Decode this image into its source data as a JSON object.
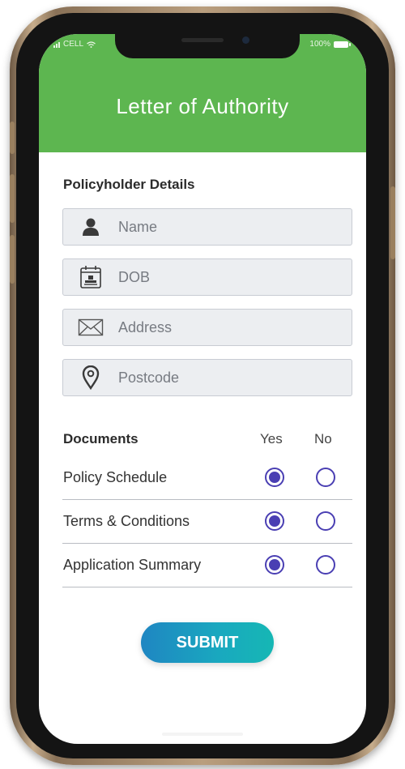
{
  "status_bar": {
    "carrier": "CELL",
    "battery": "100%"
  },
  "header": {
    "title": "Letter of Authority",
    "color": "#5db650"
  },
  "policyholder": {
    "section_label": "Policyholder Details",
    "fields": [
      {
        "icon": "person-icon",
        "placeholder": "Name",
        "value": ""
      },
      {
        "icon": "calendar-icon",
        "placeholder": "DOB",
        "value": ""
      },
      {
        "icon": "envelope-icon",
        "placeholder": "Address",
        "value": ""
      },
      {
        "icon": "location-pin-icon",
        "placeholder": "Postcode",
        "value": ""
      }
    ]
  },
  "documents": {
    "title": "Documents",
    "yes_label": "Yes",
    "no_label": "No",
    "rows": [
      {
        "label": "Policy Schedule",
        "selected": "yes"
      },
      {
        "label": "Terms & Conditions",
        "selected": "yes"
      },
      {
        "label": "Application Summary",
        "selected": "yes"
      }
    ],
    "radio_color": "#4a3fb3"
  },
  "submit": {
    "label": "SUBMIT"
  }
}
